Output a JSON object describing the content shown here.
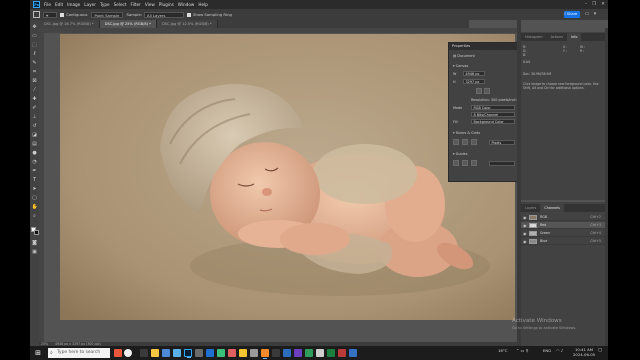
{
  "menubar": {
    "app_logo": "Ps",
    "items": [
      "File",
      "Edit",
      "Image",
      "Layer",
      "Type",
      "Select",
      "Filter",
      "View",
      "Plugins",
      "Window",
      "Help"
    ]
  },
  "options_bar": {
    "contiguous_label": "Contiguous",
    "sample_label": "Sample:",
    "sample_value": "All Layers",
    "tolerance_label": "Point Sample",
    "select_subject_label": "Show Sampling Ring",
    "share_label": "Share"
  },
  "tabs": [
    {
      "label": "DSC.jpg @ 16.7% (RGB/8) *",
      "active": false
    },
    {
      "label": "DSC.jpg @ 25% (RGB/8) *",
      "active": true
    },
    {
      "label": "DSC.jpg @ 12.5% (RGB/8) *",
      "active": false
    }
  ],
  "properties": {
    "title": "Properties",
    "document_label": "Document",
    "canvas_label": "Canvas",
    "width_value": "4946 px",
    "height_value": "3297 px",
    "resolution_label": "Resolution: 300 pixels/inch",
    "mode_label": "Mode",
    "mode_value": "RGB Color",
    "bits_value": "8 Bits/Channel",
    "fill_label": "Fill",
    "fill_value": "Background Color",
    "rulers_label": "Rulers & Grids",
    "rulers_unit": "Pixels",
    "guides_label": "Guides"
  },
  "right_panel_top": {
    "tabs": [
      "Histogram",
      "Actions",
      "Info"
    ],
    "active_tab": "Info",
    "info_lines": [
      "R:",
      "G:",
      "B:",
      "8-bit",
      "Doc: 38.9M/38.9M"
    ],
    "hint_line_1": "Click image to choose new foreground color. Use",
    "hint_line_2": "Shift, Alt and Ctrl for additional options."
  },
  "right_panel_bottom": {
    "tabs": [
      "Layers",
      "Channels"
    ],
    "active_tab": "Channels",
    "channels": [
      {
        "name": "RGB",
        "key": "Ctrl+2",
        "selected": false
      },
      {
        "name": "Red",
        "key": "Ctrl+3",
        "selected": true
      },
      {
        "name": "Green",
        "key": "Ctrl+4",
        "selected": false
      },
      {
        "name": "Blue",
        "key": "Ctrl+5",
        "selected": false
      }
    ]
  },
  "status": {
    "zoom": "25%",
    "doc_info": "4946 px x 3297 px (300 ppi)"
  },
  "watermark": {
    "title": "Activate Windows",
    "subtitle": "Go to Settings to activate Windows."
  },
  "taskbar": {
    "search_placeholder": "Type here to search",
    "weather": "16°C",
    "language": "ENG",
    "time": "10:41 AM",
    "date": "2024-06-05"
  },
  "colors": {
    "foreground": "#f2f2f2",
    "background": "#111111",
    "share_button": "#1473e6",
    "canvas_bg": "#535353"
  }
}
